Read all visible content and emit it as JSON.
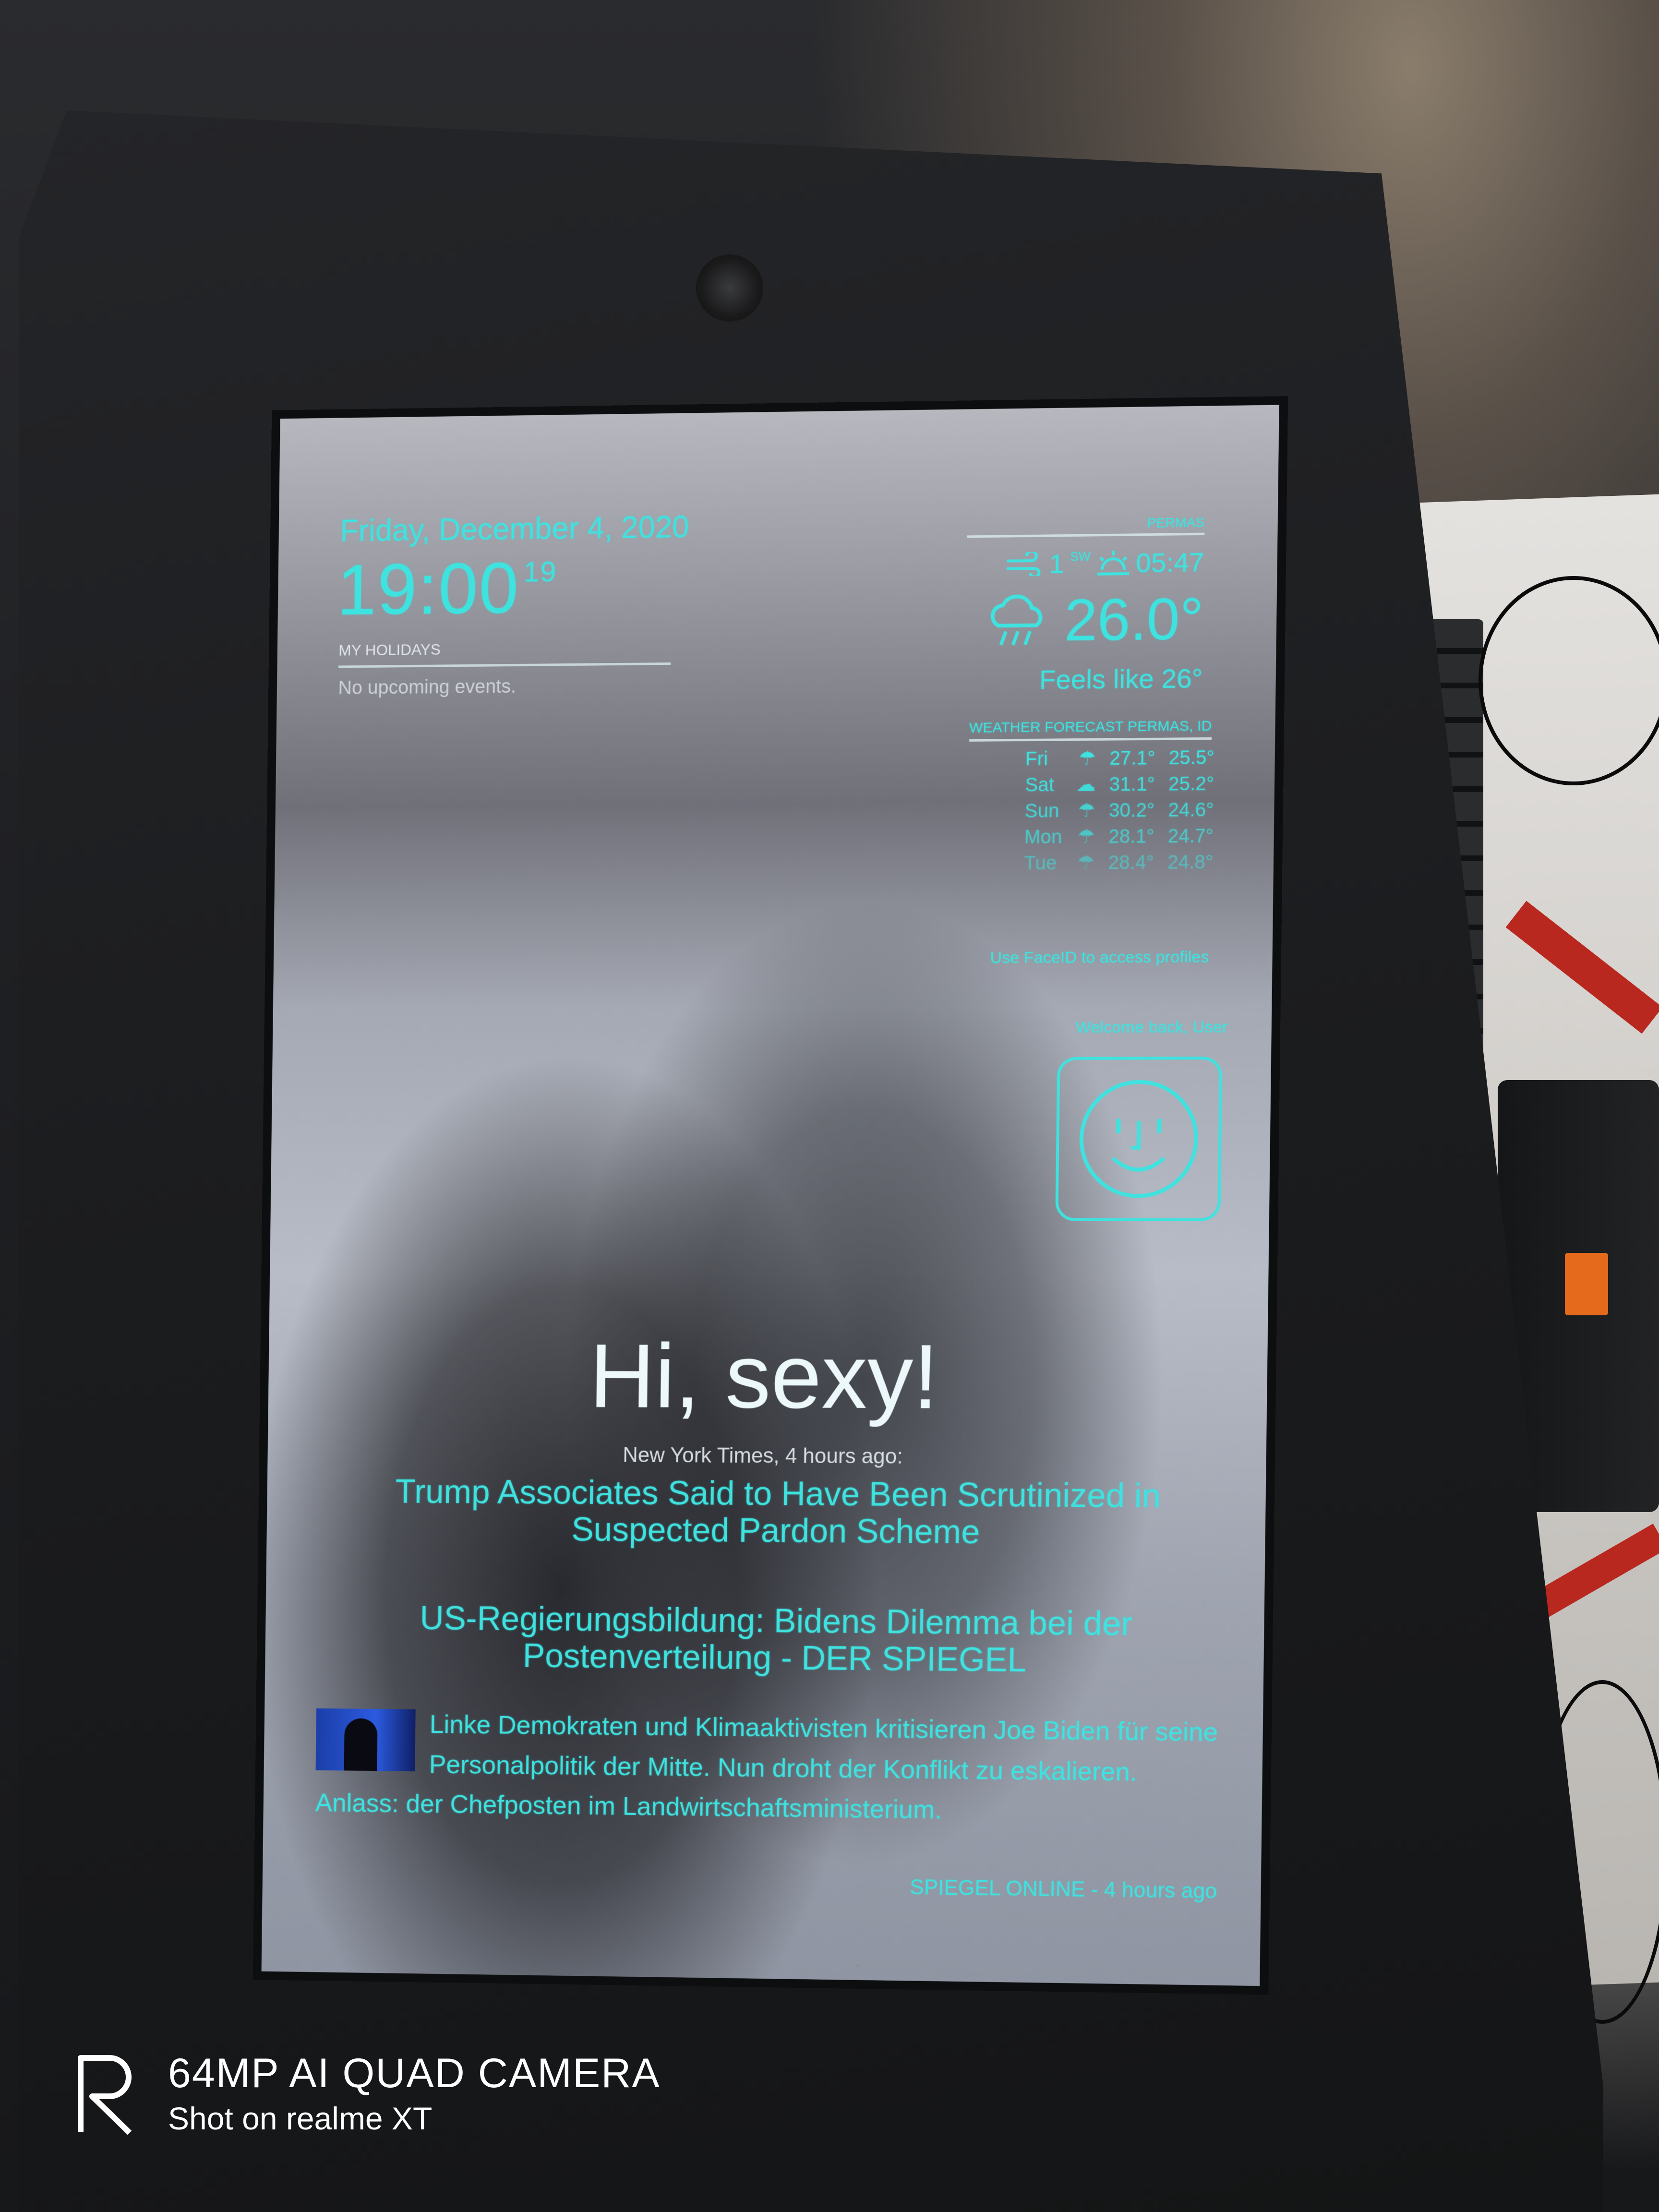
{
  "clock": {
    "date": "Friday, December 4, 2020",
    "time": "19:00",
    "seconds": "19"
  },
  "calendar": {
    "header": "MY HOLIDAYS",
    "empty_message": "No upcoming events."
  },
  "weather_current": {
    "location": "PERMAS",
    "wind_speed": "1",
    "wind_dir": "SW",
    "sunrise": "05:47",
    "temperature": "26.0°",
    "feels_like": "Feels like 26°",
    "condition_icon": "rain-cloud-icon"
  },
  "weather_forecast": {
    "header": "WEATHER FORECAST PERMAS, ID",
    "days": [
      {
        "day": "Fri",
        "icon": "rain-icon",
        "high": "27.1°",
        "low": "25.5°"
      },
      {
        "day": "Sat",
        "icon": "cloud-icon",
        "high": "31.1°",
        "low": "25.2°"
      },
      {
        "day": "Sun",
        "icon": "rain-icon",
        "high": "30.2°",
        "low": "24.6°"
      },
      {
        "day": "Mon",
        "icon": "rain-icon",
        "high": "28.1°",
        "low": "24.7°"
      },
      {
        "day": "Tue",
        "icon": "rain-icon",
        "high": "28.4°",
        "low": "24.8°"
      }
    ]
  },
  "faceid": {
    "prompt": "Use FaceID to access profiles",
    "welcome": "Welcome back, User",
    "icon": "face-id-icon"
  },
  "compliment": "Hi, sexy!",
  "news": {
    "source": "New York Times, 4 hours ago:",
    "headline": "Trump Associates Said to Have Been Scrutinized in Suspected Pardon Scheme"
  },
  "spiegel": {
    "title": "US-Regierungsbildung: Bidens Dilemma bei der Postenverteilung - DER SPIEGEL",
    "body": "Linke Demokraten und Klimaaktivisten kritisieren Joe Biden für seine Personalpolitik der Mitte. Nun droht der Konflikt zu eskalieren. Anlass: der Chefposten im Landwirtschaftsministerium.",
    "meta": "SPIEGEL ONLINE - 4 hours ago"
  },
  "watermark": {
    "line1": "64MP AI QUAD CAMERA",
    "line2": "Shot on realme XT"
  },
  "colors": {
    "accent": "#3ee3e0"
  }
}
